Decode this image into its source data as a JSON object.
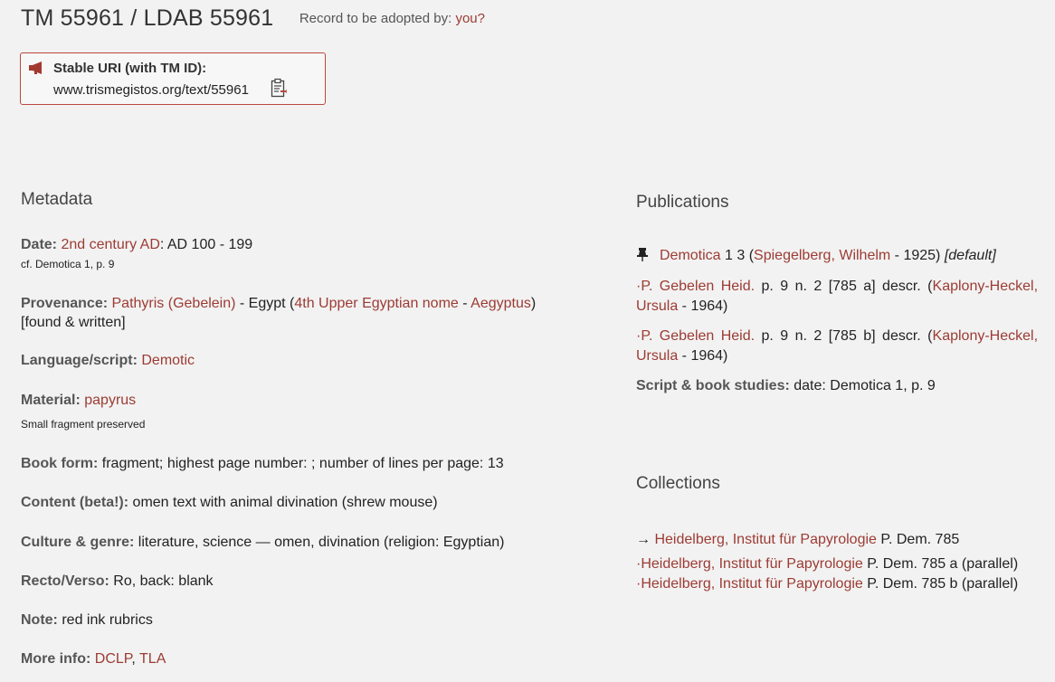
{
  "header": {
    "title": "TM 55961 / LDAB 55961",
    "adopt_label": "Record to be adopted by:",
    "adopt_link": "you?"
  },
  "uri_box": {
    "icon": "megaphone-icon",
    "label": "Stable URI (with TM ID):",
    "value": "www.trismegistos.org/text/55961",
    "copy_icon": "clipboard-icon"
  },
  "metadata": {
    "title": "Metadata",
    "date": {
      "label": "Date:",
      "link": "2nd century AD",
      "value": ": AD 100 - 199",
      "note": "cf. Demotica 1, p. 9"
    },
    "provenance": {
      "label": "Provenance:",
      "place": "Pathyris (Gebelein)",
      "sep1": " - Egypt (",
      "nome": "4th Upper Egyptian nome",
      "sep2": " - ",
      "region": "Aegyptus",
      "close": ")",
      "extra": "[found & written]"
    },
    "language": {
      "label": "Language/script:",
      "link": "Demotic"
    },
    "material": {
      "label": "Material:",
      "link": "papyrus",
      "note": "Small fragment preserved"
    },
    "book_form": {
      "label": "Book form:",
      "value": "fragment; highest page number: ; number of lines per page: 13"
    },
    "content": {
      "label": "Content (beta!):",
      "value": "omen text with animal divination (shrew mouse)"
    },
    "culture": {
      "label": "Culture & genre:",
      "value": "literature, science — omen, divination (religion: Egyptian)"
    },
    "recto_verso": {
      "label": "Recto/Verso:",
      "value": "Ro, back: blank"
    },
    "note": {
      "label": "Note:",
      "value": "red ink rubrics"
    },
    "more_info": {
      "label": "More info:",
      "link1": "DCLP",
      "sep": ", ",
      "link2": "TLA"
    }
  },
  "publications": {
    "title": "Publications",
    "items": [
      {
        "link": "Demotica",
        "text": " 1 3 (",
        "author": "Spiegelberg, Wilhelm",
        "year": " - 1925) ",
        "tag": "[default]",
        "icon": "pushpin-icon"
      },
      {
        "prefix": "·",
        "link": "P. Gebelen Heid.",
        "text": " p. 9 n. 2 [785 a] descr. (",
        "author": "Kaplony-Heckel, Ursula",
        "year": " - 1964)"
      },
      {
        "prefix": "·",
        "link": "P. Gebelen Heid.",
        "text": " p. 9 n. 2 [785 b] descr. (",
        "author": "Kaplony-Heckel, Ursula",
        "year": " - 1964)"
      }
    ],
    "script_studies": {
      "label": "Script & book studies:",
      "value": "date: Demotica 1, p. 9"
    }
  },
  "collections": {
    "title": "Collections",
    "items": [
      {
        "prefix": "→ ",
        "link": "Heidelberg, Institut für Papyrologie",
        "text": " P. Dem. 785"
      },
      {
        "prefix": "·",
        "link": "Heidelberg, Institut für Papyrologie",
        "text": " P. Dem. 785 a (parallel)"
      },
      {
        "prefix": "·",
        "link": "Heidelberg, Institut für Papyrologie",
        "text": " P. Dem. 785 b (parallel)"
      }
    ]
  },
  "colors": {
    "link": "#9c3b33",
    "border": "#b9483f",
    "background": "#f2f2f2"
  }
}
